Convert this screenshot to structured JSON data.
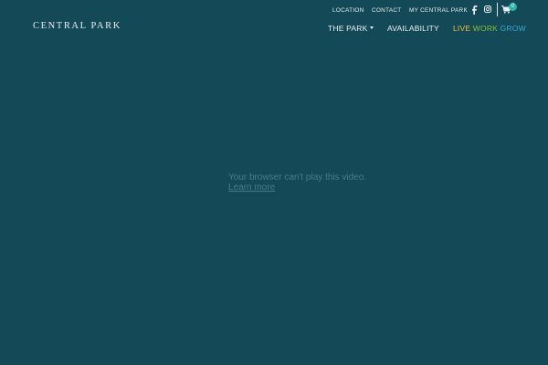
{
  "header": {
    "logo_text": "CENTRAL PARK",
    "utility_links": {
      "location": "LOCATION",
      "contact": "CONTACT",
      "my_central_park": "MY CENTRAL PARK"
    },
    "social_icons": [
      "facebook-icon",
      "instagram-icon"
    ],
    "cart": {
      "icon": "shopping-cart-icon",
      "count": "0"
    },
    "main_nav": {
      "the_park": "THE PARK",
      "availability": "AVAILABILITY",
      "live": "LIVE",
      "work": "WORK",
      "grow": "GROW"
    }
  },
  "video": {
    "message": "Your browser can't play this video.",
    "learn_more": "Learn more"
  },
  "colors": {
    "background": "#144a58",
    "live": "#e4c33a",
    "work": "#83bf3c",
    "grow": "#3aa7d6",
    "cart_badge": "#2bb3a6"
  }
}
